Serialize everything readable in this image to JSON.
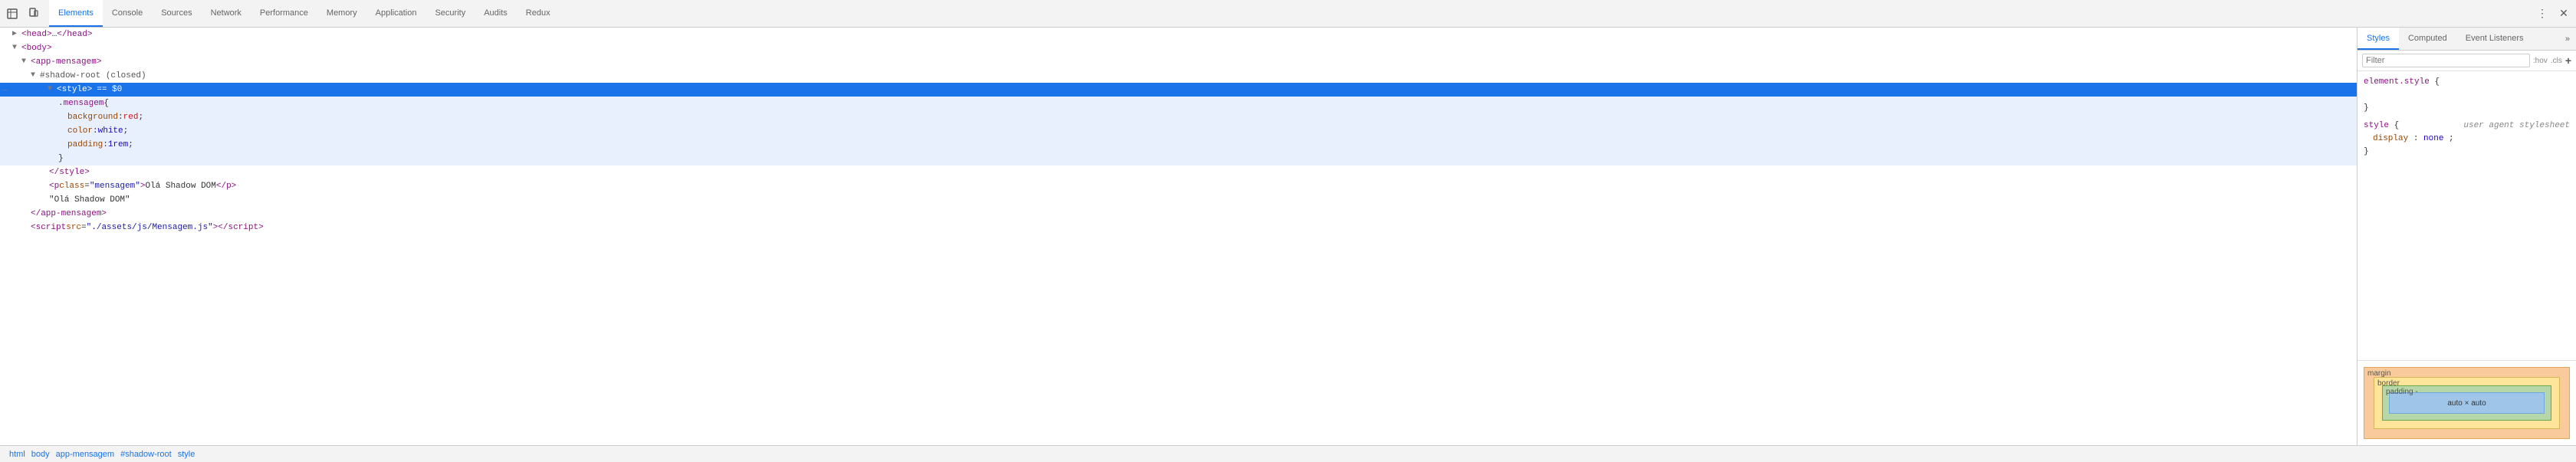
{
  "toolbar": {
    "icons": [
      {
        "name": "inspect-icon",
        "symbol": "⬚"
      },
      {
        "name": "device-icon",
        "symbol": "⧉"
      }
    ],
    "tabs": [
      {
        "id": "elements",
        "label": "Elements",
        "active": true
      },
      {
        "id": "console",
        "label": "Console",
        "active": false
      },
      {
        "id": "sources",
        "label": "Sources",
        "active": false
      },
      {
        "id": "network",
        "label": "Network",
        "active": false
      },
      {
        "id": "performance",
        "label": "Performance",
        "active": false
      },
      {
        "id": "memory",
        "label": "Memory",
        "active": false
      },
      {
        "id": "application",
        "label": "Application",
        "active": false
      },
      {
        "id": "security",
        "label": "Security",
        "active": false
      },
      {
        "id": "audits",
        "label": "Audits",
        "active": false
      },
      {
        "id": "redux",
        "label": "Redux",
        "active": false
      }
    ]
  },
  "dom": {
    "lines": [
      {
        "id": "head",
        "indent": 1,
        "triangle": "collapsed",
        "content_html": "head_collapsed"
      },
      {
        "id": "body",
        "indent": 1,
        "triangle": "expanded",
        "content_html": "body_open"
      },
      {
        "id": "app-mensagem",
        "indent": 2,
        "triangle": "expanded",
        "content_html": "app_open"
      },
      {
        "id": "shadow-root",
        "indent": 3,
        "triangle": "expanded",
        "content_html": "shadow_open"
      },
      {
        "id": "style-selected",
        "indent": 4,
        "triangle": "expanded",
        "selected": true,
        "content_html": "style_open"
      },
      {
        "id": "css-mensagem",
        "indent": 6,
        "content_html": "css_selector"
      },
      {
        "id": "css-bg",
        "indent": 7,
        "content_html": "css_bg"
      },
      {
        "id": "css-color",
        "indent": 7,
        "content_html": "css_color"
      },
      {
        "id": "css-padding",
        "indent": 7,
        "content_html": "css_padding"
      },
      {
        "id": "css-close",
        "indent": 6,
        "content_html": "css_close_brace"
      },
      {
        "id": "style-close",
        "indent": 4,
        "content_html": "style_close"
      },
      {
        "id": "p-tag",
        "indent": 4,
        "content_html": "p_tag"
      },
      {
        "id": "text-shadow",
        "indent": 4,
        "content_html": "text_shadow"
      },
      {
        "id": "app-close",
        "indent": 2,
        "content_html": "app_close"
      },
      {
        "id": "script-tag",
        "indent": 2,
        "content_html": "script_tag"
      }
    ]
  },
  "right_panel": {
    "tabs": [
      {
        "id": "styles",
        "label": "Styles",
        "active": true
      },
      {
        "id": "computed",
        "label": "Computed",
        "active": false
      },
      {
        "id": "event-listeners",
        "label": "Event Listeners",
        "active": false
      }
    ],
    "filter_placeholder": "Filter",
    "filter_pseudo": ":hov",
    "filter_cls": ".cls",
    "styles": {
      "rules": [
        {
          "selector": "element.style",
          "source": "",
          "lines": [
            {
              "prop": "",
              "value": "",
              "open_brace": true
            },
            {
              "prop": "",
              "value": "",
              "close_brace": true
            }
          ]
        },
        {
          "selector": "style",
          "source": "user agent stylesheet",
          "lines": [
            {
              "prop": "display",
              "value": "none",
              "strikethrough": false
            }
          ]
        }
      ]
    },
    "box_model": {
      "margin_label": "margin",
      "border_label": "border",
      "padding_label": "padding -",
      "content_label": "auto × auto"
    }
  },
  "breadcrumb": {
    "items": [
      "html",
      "body",
      "app-mensagem",
      "#shadow-root",
      "style"
    ]
  }
}
